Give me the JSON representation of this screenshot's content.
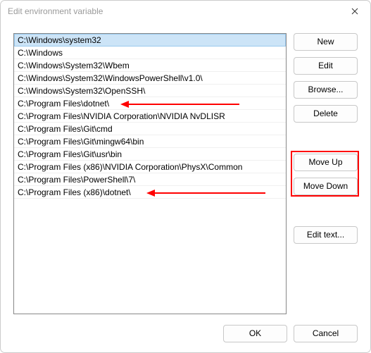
{
  "window": {
    "title": "Edit environment variable"
  },
  "list": {
    "items": [
      "C:\\Windows\\system32",
      "C:\\Windows",
      "C:\\Windows\\System32\\Wbem",
      "C:\\Windows\\System32\\WindowsPowerShell\\v1.0\\",
      "C:\\Windows\\System32\\OpenSSH\\",
      "C:\\Program Files\\dotnet\\",
      "C:\\Program Files\\NVIDIA Corporation\\NVIDIA NvDLISR",
      "C:\\Program Files\\Git\\cmd",
      "C:\\Program Files\\Git\\mingw64\\bin",
      "C:\\Program Files\\Git\\usr\\bin",
      "C:\\Program Files (x86)\\NVIDIA Corporation\\PhysX\\Common",
      "C:\\Program Files\\PowerShell\\7\\",
      "C:\\Program Files (x86)\\dotnet\\"
    ],
    "selected_index": 0
  },
  "buttons": {
    "new": "New",
    "edit": "Edit",
    "browse": "Browse...",
    "delete": "Delete",
    "move_up": "Move Up",
    "move_down": "Move Down",
    "edit_text": "Edit text...",
    "ok": "OK",
    "cancel": "Cancel"
  },
  "annotations": {
    "highlight_move_buttons": true,
    "arrows_point_to_indices": [
      5,
      12
    ],
    "arrow_color": "#ff0000"
  }
}
